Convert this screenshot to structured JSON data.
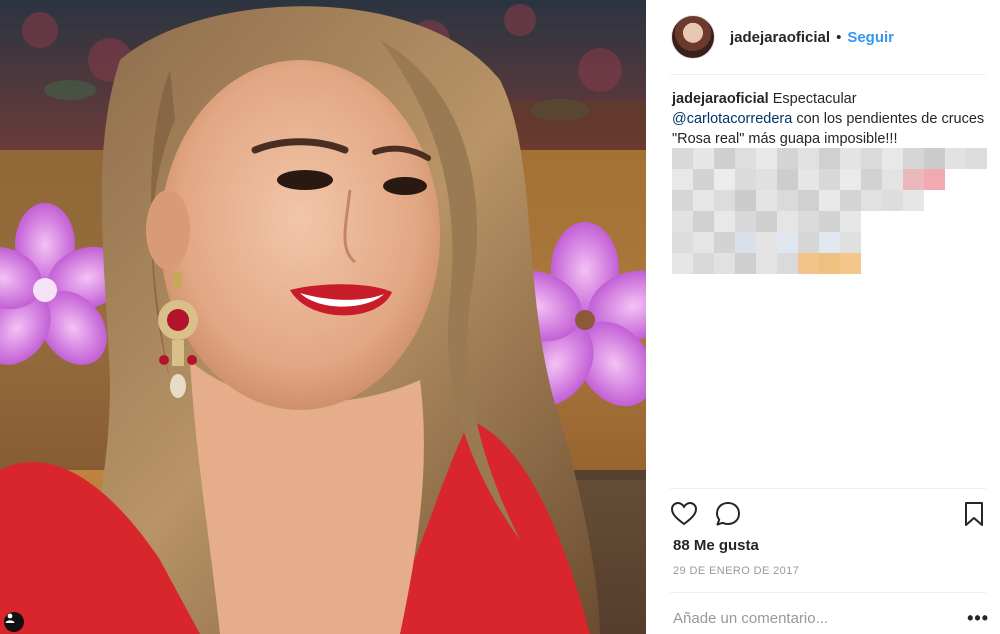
{
  "post": {
    "username": "jadejaraoficial",
    "separator": "•",
    "follow_label": "Seguir",
    "caption": {
      "username": "jadejaraoficial",
      "text_before": "Espectacular",
      "mention": "@carlotacorredera",
      "text_after": "con los pendientes de cruces \"Rosa real\" más guapa imposible!!!"
    },
    "likes": "88 Me gusta",
    "date": "29 DE ENERO DE 2017",
    "comment_placeholder": "Añade un comentario...",
    "more_label": "•••"
  },
  "icons": {
    "like": "heart-icon",
    "comment": "comment-bubble-icon",
    "save": "bookmark-icon",
    "more": "more-options-icon",
    "photo_corner": "user-tag-icon"
  },
  "colors": {
    "follow": "#3897f0",
    "mention": "#003569",
    "muted": "#999999",
    "text": "#262626"
  }
}
